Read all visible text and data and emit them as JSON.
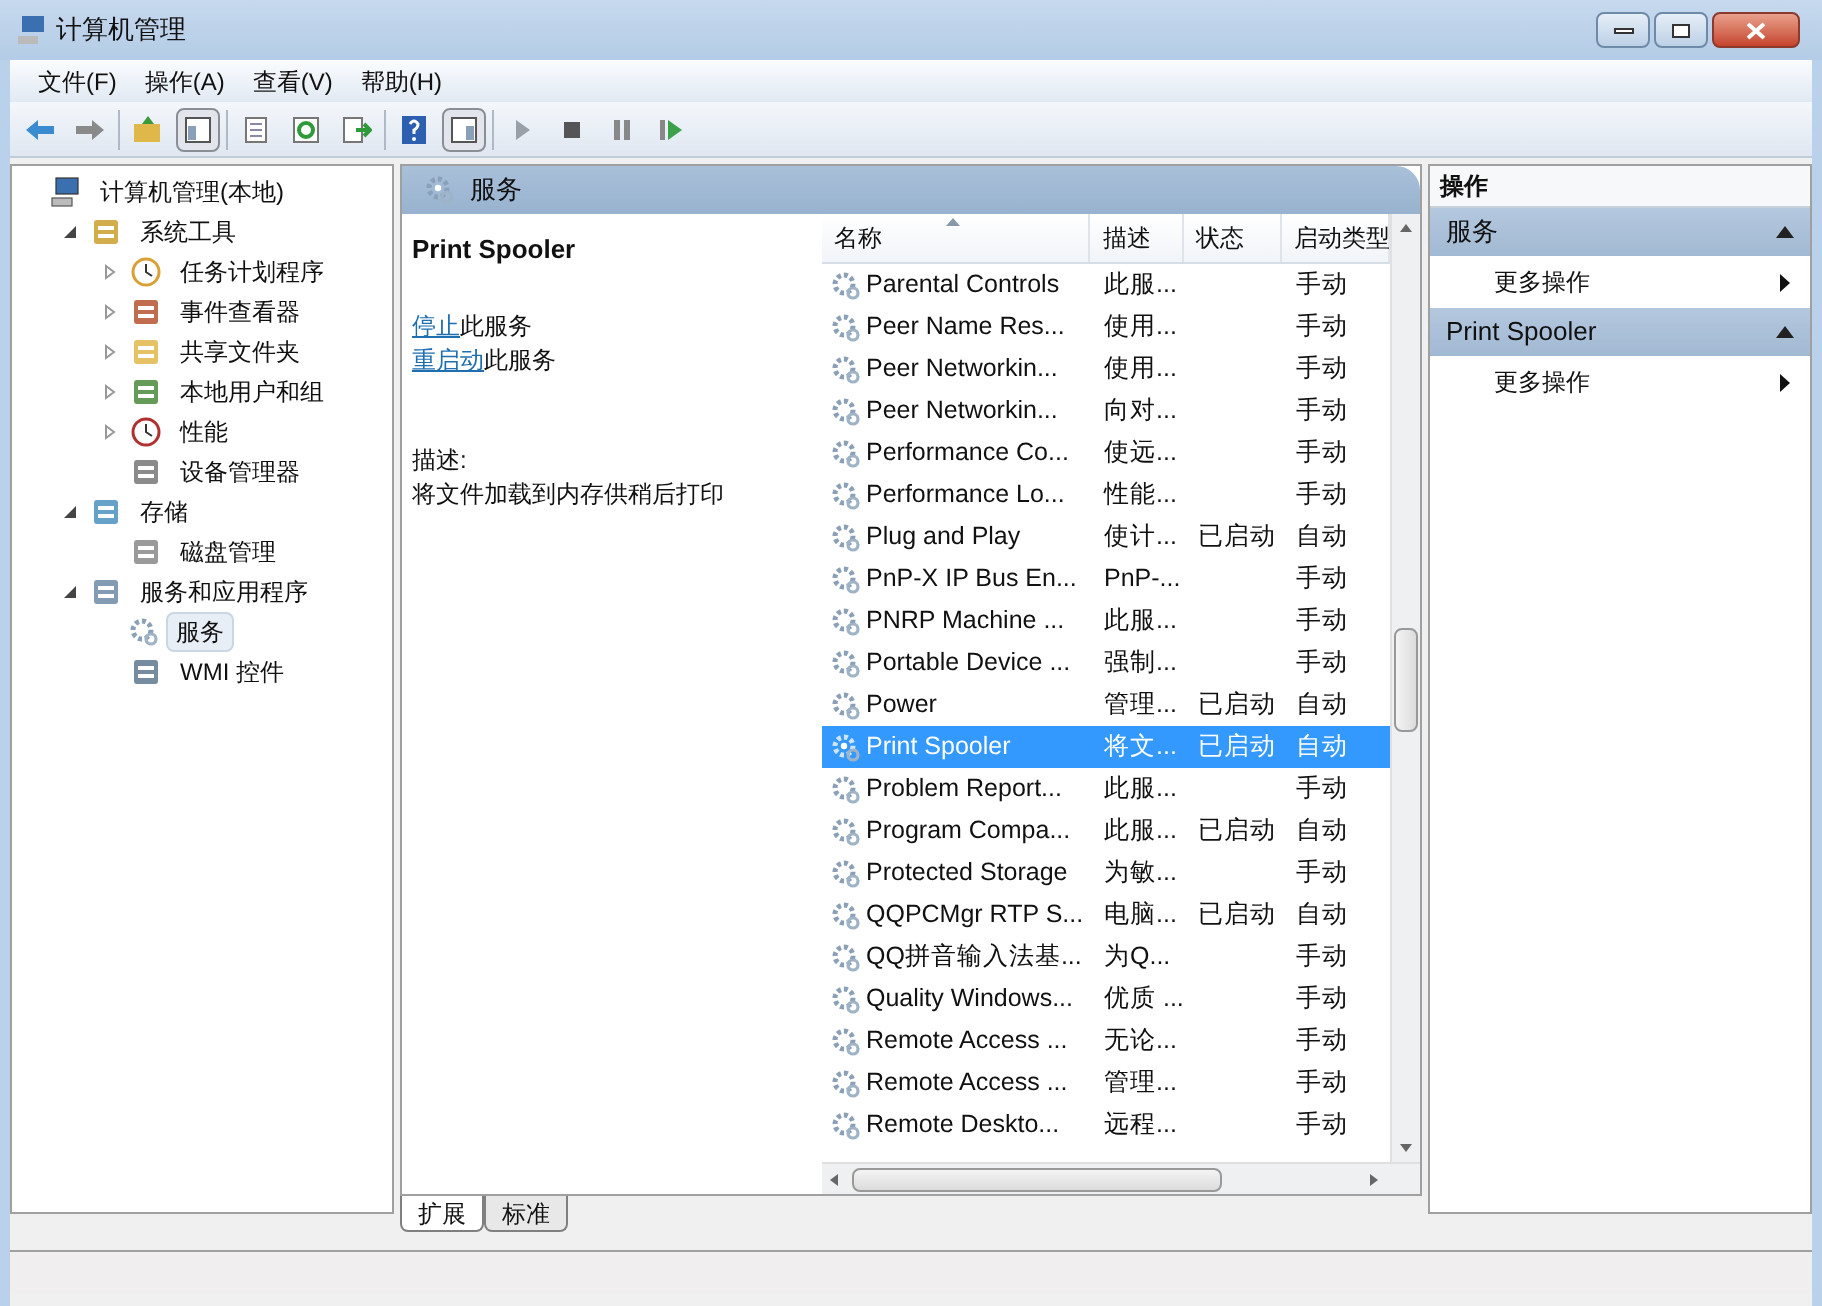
{
  "window": {
    "title": "计算机管理"
  },
  "menu": [
    "文件(F)",
    "操作(A)",
    "查看(V)",
    "帮助(H)"
  ],
  "tree": [
    {
      "label": "计算机管理(本地)",
      "selected": false,
      "children": [
        {
          "label": "系统工具",
          "expanded": true,
          "selected": false,
          "children": [
            {
              "label": "任务计划程序",
              "expanded": false,
              "selected": false
            },
            {
              "label": "事件查看器",
              "expanded": false,
              "selected": false
            },
            {
              "label": "共享文件夹",
              "expanded": false,
              "selected": false
            },
            {
              "label": "本地用户和组",
              "expanded": false,
              "selected": false
            },
            {
              "label": "性能",
              "expanded": false,
              "selected": false
            },
            {
              "label": "设备管理器",
              "selected": false
            }
          ]
        },
        {
          "label": "存储",
          "expanded": true,
          "selected": false,
          "children": [
            {
              "label": "磁盘管理",
              "selected": false
            }
          ]
        },
        {
          "label": "服务和应用程序",
          "expanded": true,
          "selected": false,
          "children": [
            {
              "label": "服务",
              "selected": true
            },
            {
              "label": "WMI 控件",
              "selected": false
            }
          ]
        }
      ]
    }
  ],
  "panel_header": "服务",
  "detail": {
    "title": "Print Spooler",
    "links": [
      {
        "link": "停止",
        "text": "此服务"
      },
      {
        "link": "重启动",
        "text": "此服务"
      }
    ],
    "description_label": "描述:",
    "description": "将文件加载到内存供稍后打印"
  },
  "table": {
    "columns": [
      "名称",
      "描述",
      "状态",
      "启动类型"
    ],
    "rows": [
      {
        "name": "Parental Controls",
        "desc": "此服...",
        "status": "",
        "startup": "手动",
        "selected": false
      },
      {
        "name": "Peer Name Res...",
        "desc": "使用...",
        "status": "",
        "startup": "手动",
        "selected": false
      },
      {
        "name": "Peer Networkin...",
        "desc": "使用...",
        "status": "",
        "startup": "手动",
        "selected": false
      },
      {
        "name": "Peer Networkin...",
        "desc": "向对...",
        "status": "",
        "startup": "手动",
        "selected": false
      },
      {
        "name": "Performance Co...",
        "desc": "使远...",
        "status": "",
        "startup": "手动",
        "selected": false
      },
      {
        "name": "Performance Lo...",
        "desc": "性能...",
        "status": "",
        "startup": "手动",
        "selected": false
      },
      {
        "name": "Plug and Play",
        "desc": "使计...",
        "status": "已启动",
        "startup": "自动",
        "selected": false
      },
      {
        "name": "PnP-X IP Bus En...",
        "desc": "PnP-...",
        "status": "",
        "startup": "手动",
        "selected": false
      },
      {
        "name": "PNRP Machine ...",
        "desc": "此服...",
        "status": "",
        "startup": "手动",
        "selected": false
      },
      {
        "name": "Portable Device ...",
        "desc": "强制...",
        "status": "",
        "startup": "手动",
        "selected": false
      },
      {
        "name": "Power",
        "desc": "管理...",
        "status": "已启动",
        "startup": "自动",
        "selected": false
      },
      {
        "name": "Print Spooler",
        "desc": "将文...",
        "status": "已启动",
        "startup": "自动",
        "selected": true
      },
      {
        "name": "Problem Report...",
        "desc": "此服...",
        "status": "",
        "startup": "手动",
        "selected": false
      },
      {
        "name": "Program Compa...",
        "desc": "此服...",
        "status": "已启动",
        "startup": "自动",
        "selected": false
      },
      {
        "name": "Protected Storage",
        "desc": "为敏...",
        "status": "",
        "startup": "手动",
        "selected": false
      },
      {
        "name": "QQPCMgr RTP S...",
        "desc": "电脑...",
        "status": "已启动",
        "startup": "自动",
        "selected": false
      },
      {
        "name": "QQ拼音输入法基...",
        "desc": "为Q...",
        "status": "",
        "startup": "手动",
        "selected": false
      },
      {
        "name": "Quality Windows...",
        "desc": "优质 ...",
        "status": "",
        "startup": "手动",
        "selected": false
      },
      {
        "name": "Remote Access ...",
        "desc": "无论...",
        "status": "",
        "startup": "手动",
        "selected": false
      },
      {
        "name": "Remote Access ...",
        "desc": "管理...",
        "status": "",
        "startup": "手动",
        "selected": false
      },
      {
        "name": "Remote Deskto...",
        "desc": "远程...",
        "status": "",
        "startup": "手动",
        "selected": false
      }
    ]
  },
  "view_tabs": [
    {
      "label": "扩展",
      "selected": true
    },
    {
      "label": "标准",
      "selected": false
    }
  ],
  "actions": {
    "title": "操作",
    "sections": [
      {
        "title": "服务",
        "items": [
          "更多操作"
        ]
      },
      {
        "title": "Print Spooler",
        "items": [
          "更多操作"
        ]
      }
    ]
  }
}
